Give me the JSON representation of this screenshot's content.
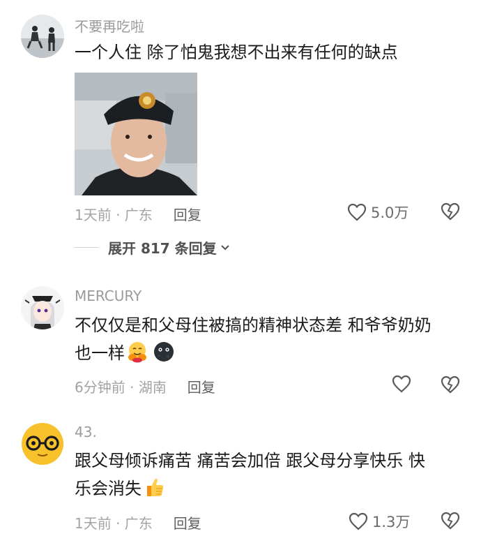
{
  "comments": [
    {
      "username": "不要再吃啦",
      "text": "一个人住 除了怕鬼我想不出来有任何的缺点",
      "meta": "1天前 · 广东",
      "reply_label": "回复",
      "likes": "5.0万",
      "expand_label": "展开 817 条回复"
    },
    {
      "username": "MERCURY",
      "text_line1": "不仅仅是和父母住被搞的精神状态差 和爷爷奶奶",
      "text_line2": "也一样",
      "meta": "6分钟前 · 湖南",
      "reply_label": "回复"
    },
    {
      "username": "43.",
      "text_line1": "跟父母倾诉痛苦 痛苦会加倍 跟父母分享快乐 快",
      "text_line2": "乐会消失",
      "meta": "1天前 · 广东",
      "reply_label": "回复",
      "likes": "1.3万"
    }
  ],
  "icons": {
    "like": "heart-outline-icon",
    "dislike": "broken-heart-icon",
    "expand": "chevron-down-icon",
    "emoji1": "hugging-face-emoji",
    "emoji2": "dark-moon-face-emoji",
    "emoji3": "thumbs-up-emoji"
  }
}
